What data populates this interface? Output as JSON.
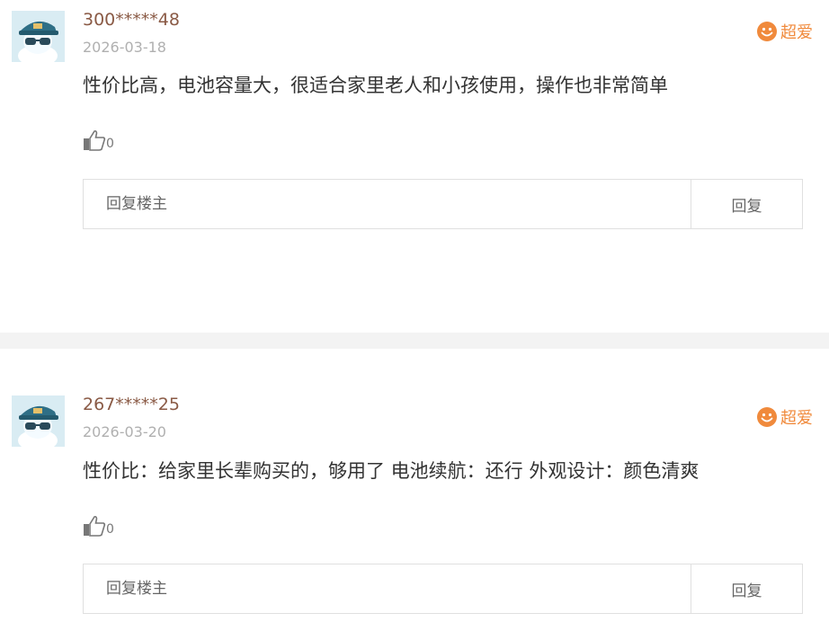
{
  "reviews": [
    {
      "user": "300*****48",
      "date": "2026-03-18",
      "rating_label": "超爱",
      "content": "性价比高，电池容量大，很适合家里老人和小孩使用，操作也非常简单",
      "likes": "0",
      "reply_placeholder": "回复楼主",
      "reply_button": "回复"
    },
    {
      "user": "267*****25",
      "date": "2026-03-20",
      "rating_label": "超爱",
      "content": "性价比：给家里长辈购买的，够用了 电池续航：还行 外观设计：颜色清爽",
      "likes": "0",
      "reply_placeholder": "回复楼主",
      "reply_button": "回复"
    }
  ],
  "icons": {
    "avatar": "avatar-icon",
    "rating": "smiley-icon",
    "like": "thumbs-up-icon"
  },
  "colors": {
    "username": "#8a5a45",
    "rating": "#f08a3c",
    "date": "#b0b0b0",
    "divider": "#f3f3f3"
  }
}
